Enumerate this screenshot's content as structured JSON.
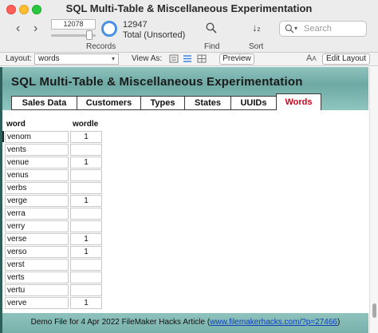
{
  "window": {
    "title": "SQL Multi-Table & Miscellaneous Experimentation"
  },
  "toolbar": {
    "record_number": "12078",
    "total_count": "12947",
    "total_status": "Total (Unsorted)",
    "records_label": "Records",
    "find_label": "Find",
    "sort_label": "Sort",
    "search_placeholder": "Search"
  },
  "layout_bar": {
    "layout_label": "Layout:",
    "layout_value": "words",
    "view_as_label": "View As:",
    "preview_label": "Preview",
    "edit_layout_label": "Edit Layout"
  },
  "layout": {
    "title": "SQL Multi-Table & Miscellaneous Experimentation",
    "tabs": [
      {
        "label": "Sales Data",
        "active": false
      },
      {
        "label": "Customers",
        "active": false
      },
      {
        "label": "Types",
        "active": false
      },
      {
        "label": "States",
        "active": false
      },
      {
        "label": "UUIDs",
        "active": false
      },
      {
        "label": "Words",
        "active": true
      }
    ],
    "columns": {
      "word": "word",
      "wordle": "wordle"
    },
    "rows": [
      {
        "word": "venom",
        "wordle": "1"
      },
      {
        "word": "vents",
        "wordle": ""
      },
      {
        "word": "venue",
        "wordle": "1"
      },
      {
        "word": "venus",
        "wordle": ""
      },
      {
        "word": "verbs",
        "wordle": ""
      },
      {
        "word": "verge",
        "wordle": "1"
      },
      {
        "word": "verra",
        "wordle": ""
      },
      {
        "word": "verry",
        "wordle": ""
      },
      {
        "word": "verse",
        "wordle": "1"
      },
      {
        "word": "verso",
        "wordle": "1"
      },
      {
        "word": "verst",
        "wordle": ""
      },
      {
        "word": "verts",
        "wordle": ""
      },
      {
        "word": "vertu",
        "wordle": ""
      },
      {
        "word": "verve",
        "wordle": "1"
      }
    ],
    "footer_text": "Demo File for 4 Apr 2022 FileMaker Hacks Article (",
    "footer_link": "www.filemakerhacks.com/?p=27466",
    "footer_close": ")"
  },
  "colors": {
    "accent_teal": "#8fc2bd",
    "active_tab_text": "#d0021b",
    "link": "#0b3dbd"
  }
}
